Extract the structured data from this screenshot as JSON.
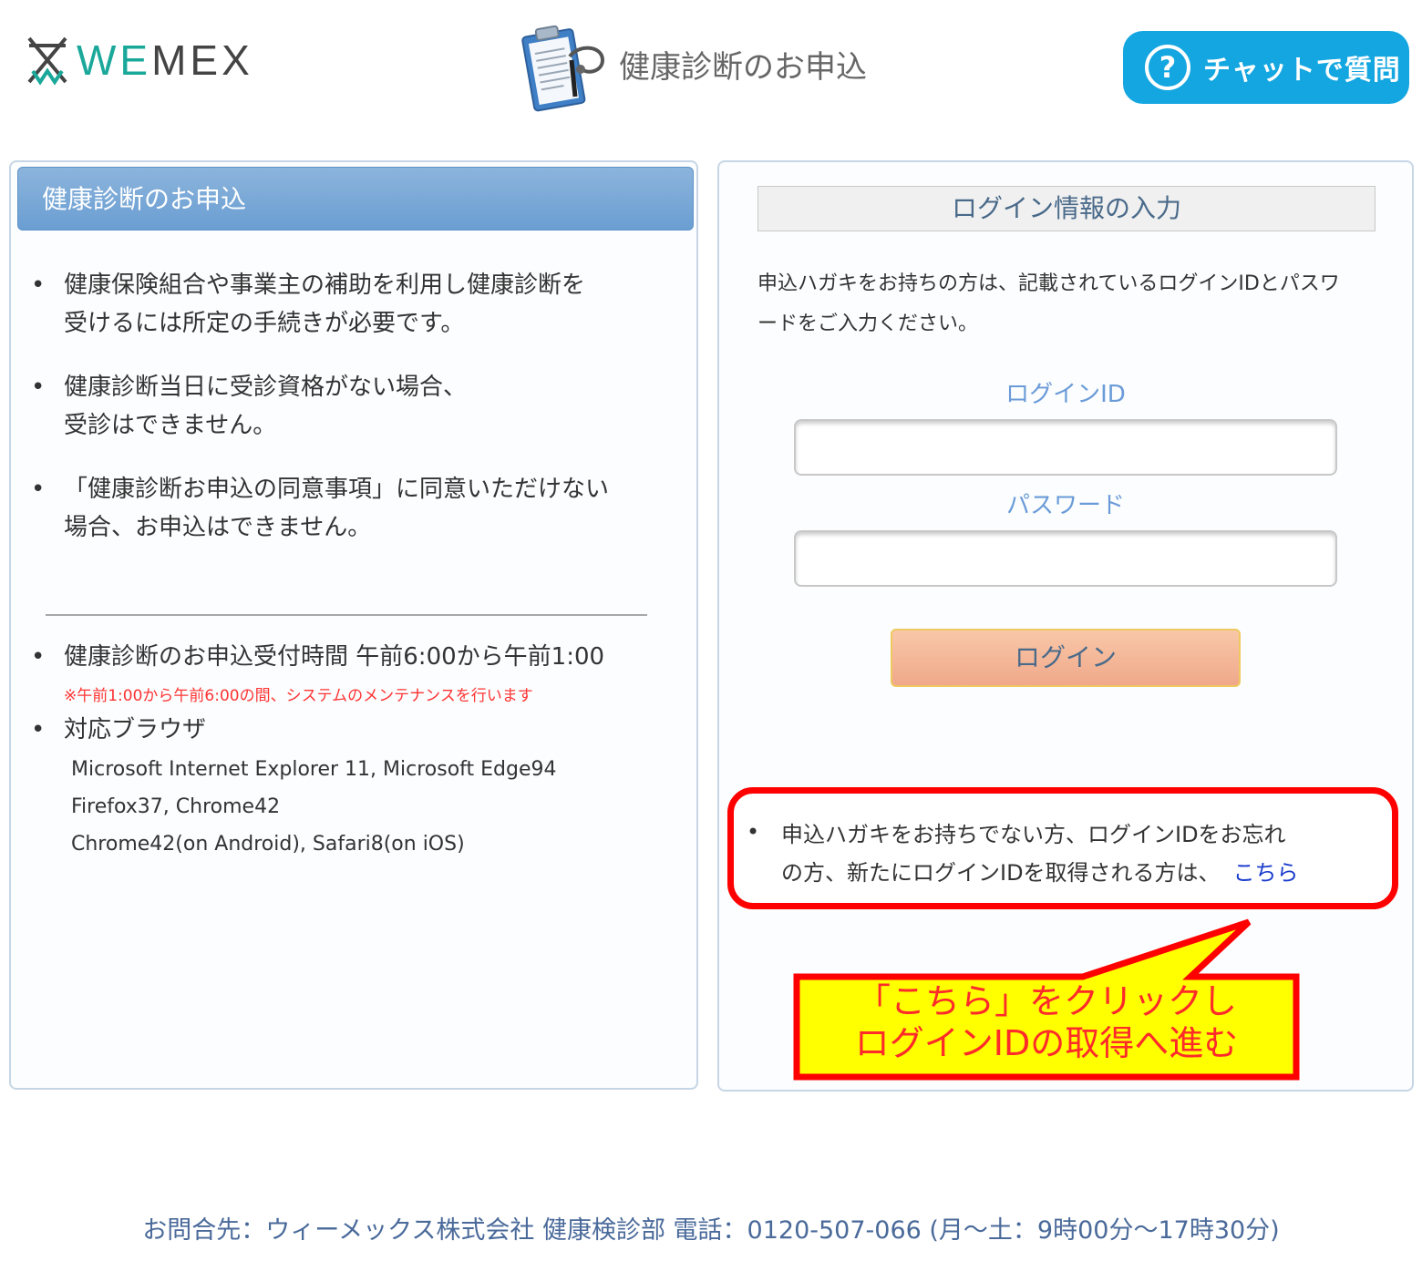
{
  "header": {
    "logo_we": "WE",
    "logo_mex": "MEX",
    "app_title": "健康診断のお申込",
    "chat_icon": "?",
    "chat_label": "チャットで質問"
  },
  "left_panel": {
    "title": "健康診断のお申込",
    "notes": [
      [
        "健康保険組合や事業主の補助を利用し健康診断を",
        "受けるには所定の手続きが必要です。"
      ],
      [
        "健康診断当日に受診資格がない場合、",
        "受診はできません。"
      ],
      [
        "「健康診断お申込の同意事項」に同意いただけない",
        "場合、お申込はできません。"
      ]
    ],
    "hours": "健康診断のお申込受付時間 午前6:00から午前1:00",
    "maintenance_note": "※午前1:00から午前6:00の間、システムのメンテナンスを行います",
    "browsers_title": "対応ブラウザ",
    "browsers": [
      "Microsoft Internet Explorer 11, Microsoft Edge94",
      "Firefox37, Chrome42",
      "Chrome42(on Android), Safari8(on iOS)"
    ]
  },
  "login": {
    "title": "ログイン情報の入力",
    "description_line1": "申込ハガキをお持ちの方は、記載されているログインIDとパスワ",
    "description_line2": "ードをご入力ください。",
    "id_label": "ログインID",
    "id_value": "",
    "password_label": "パスワード",
    "password_value": "",
    "button": "ログイン",
    "notice_line1": "申込ハガキをお持ちでない方、ログインIDをお忘れ",
    "notice_line2": "の方、新たにログインIDを取得される方は、",
    "notice_link": "こちら"
  },
  "callout": {
    "line1": "「こちら」をクリックし",
    "line2": "ログインIDの取得へ進む"
  },
  "footer": {
    "contact": "お問合先：ウィーメックス株式会社 健康検診部 電話：0120-507-066 (月～土：9時00分～17時30分)"
  },
  "colors": {
    "brand_teal": "#1aa89a",
    "chat_blue": "#13a6e0",
    "header_blue": "#6a9ed2",
    "highlight_red": "#ff0000",
    "callout_yellow": "#ffff00",
    "link_blue": "#1a3ccc"
  },
  "icons": {
    "logo": "wemex-logo-mark",
    "title": "clipboard-stethoscope-icon",
    "chat": "question-circle-icon"
  }
}
